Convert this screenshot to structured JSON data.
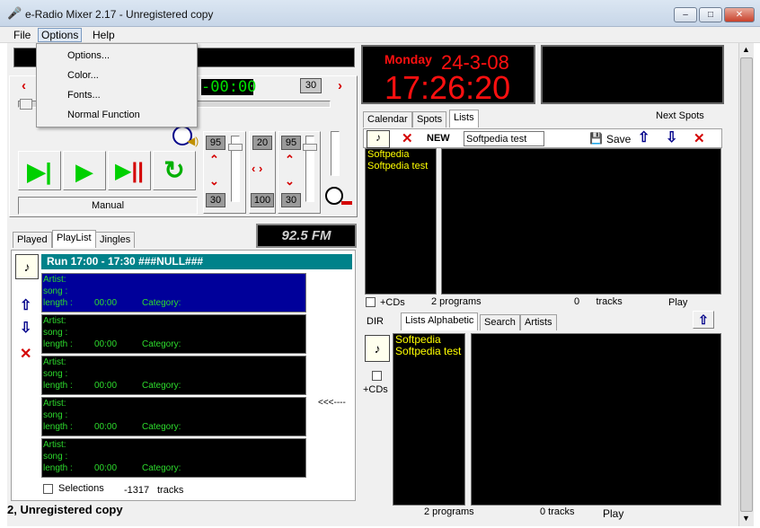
{
  "window": {
    "title": "e-Radio Mixer 2.17 - Unregistered copy",
    "minimize": "–",
    "maximize": "□",
    "close": "✕"
  },
  "menu": {
    "file": "File",
    "options": "Options",
    "help": "Help",
    "options_items": [
      "Options...",
      "Color...",
      "Fonts...",
      "Normal Function"
    ]
  },
  "player": {
    "time_display": "-00:00",
    "counter": "30",
    "mode_label": "Manual",
    "vol_left_top": "95",
    "vol_left_bottom": "30",
    "mid_top": "20",
    "mid_bottom": "100",
    "vol_right_top": "95",
    "vol_right_bottom": "30"
  },
  "clock": {
    "day": "Monday",
    "date": "24-3-08",
    "time": "17:26:20"
  },
  "lists_panel": {
    "tabs": [
      "Calendar",
      "Spots",
      "Lists"
    ],
    "next_spots": "Next Spots",
    "new_label": "NEW",
    "name_value": "Softpedia test",
    "save_label": "Save",
    "items": [
      "Softpedia",
      "Softpedia test"
    ],
    "cds_label": "+CDs",
    "programs": "2  programs",
    "tracks": "0      tracks",
    "play": "Play"
  },
  "dir_panel": {
    "tabs": [
      "DIR",
      "Lists Alphabetic",
      "Search",
      "Artists"
    ],
    "items": [
      "Softpedia",
      "Softpedia test"
    ],
    "cds_label": "+CDs",
    "programs": "2  programs",
    "tracks": "0 tracks",
    "play": "Play"
  },
  "playlist": {
    "tabs": [
      "Played",
      "PlayList",
      "Jingles"
    ],
    "logo_text": "92.5 FM",
    "header": "Run  17:00 - 17:30      ###NULL###",
    "slot_labels": {
      "artist": "Artist:",
      "song": "song :",
      "length": "length :",
      "time": "00:00",
      "category": "Category:"
    },
    "slot_count": 5,
    "arrow_marker": "<<<----",
    "selection_label": "Selections",
    "total": "-1317",
    "tracks_label": "tracks"
  },
  "status": {
    "text": "2, Unregistered copy"
  },
  "colors": {
    "accent_teal": "#00828a",
    "slot_selected": "#00009a",
    "led_green": "#00e000",
    "clock_red": "#ff1010"
  }
}
